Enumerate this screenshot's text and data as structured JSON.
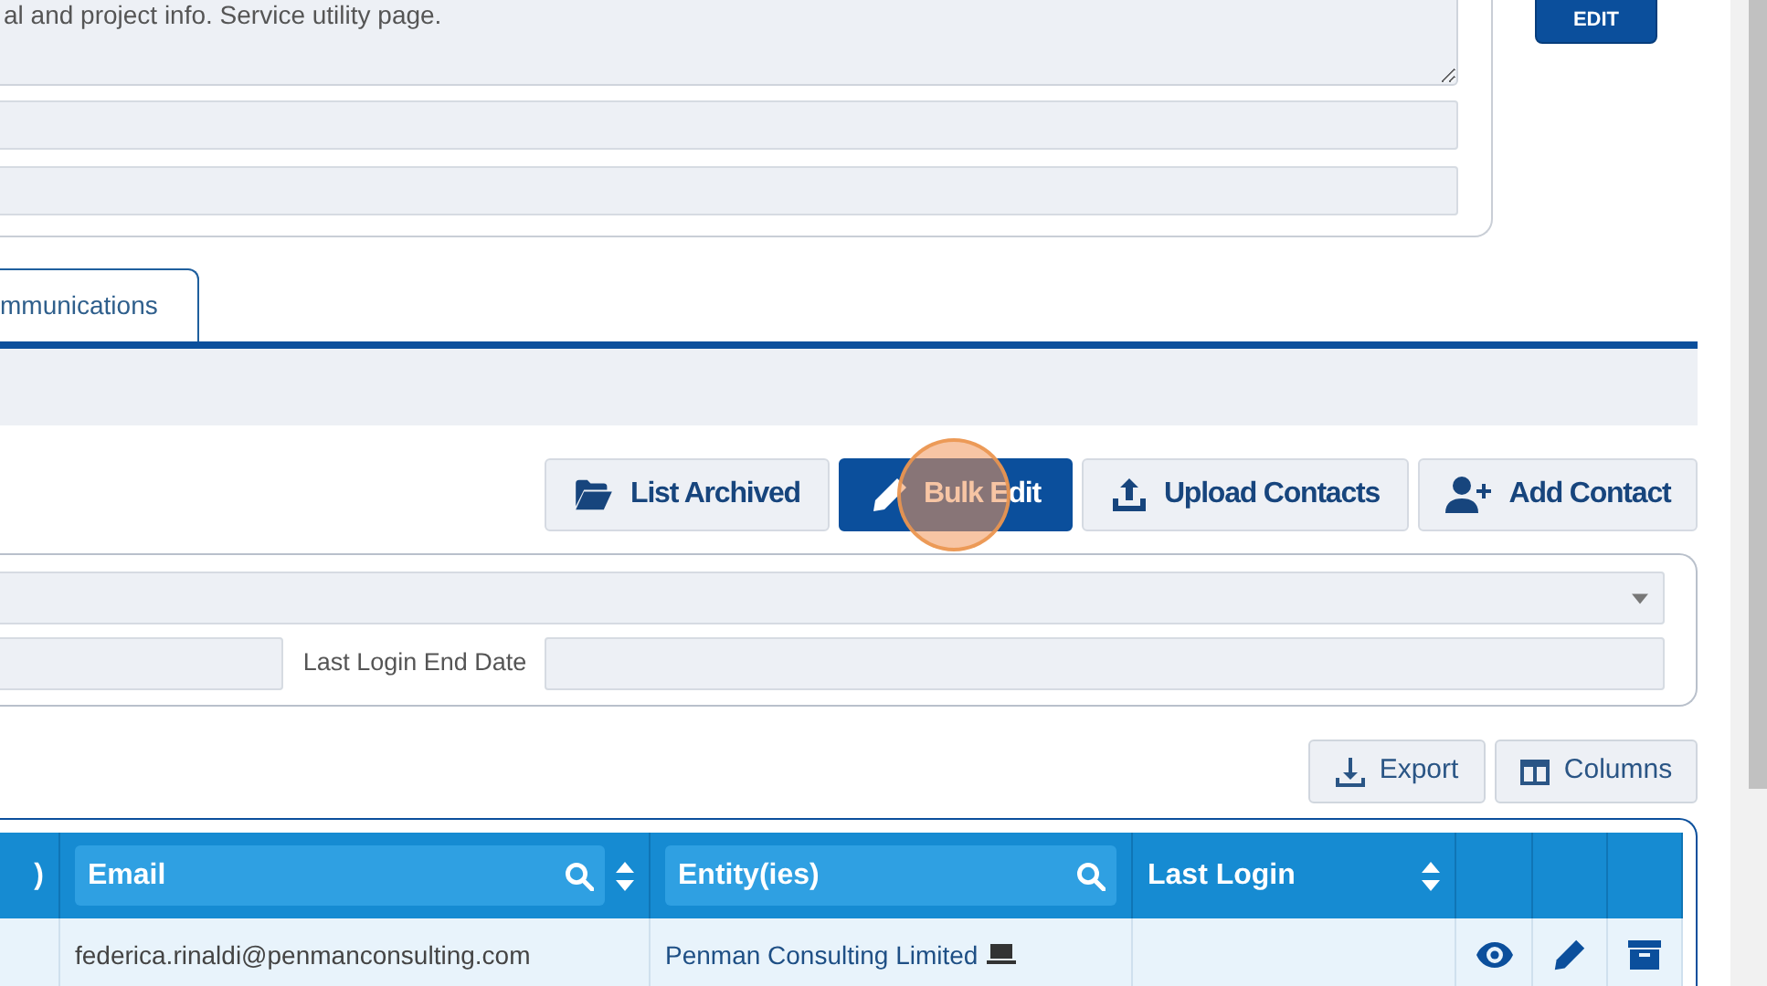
{
  "description": "al and project info. Service utility page.",
  "edit_button": "EDIT",
  "tabs": [
    {
      "label": "mmunications",
      "selected": true
    }
  ],
  "actions": [
    {
      "label": "List Archived",
      "primary": false
    },
    {
      "label": "Bulk Edit",
      "primary": true,
      "clicked": true
    },
    {
      "label": "Upload Contacts",
      "primary": false
    },
    {
      "label": "Add Contact",
      "primary": false
    }
  ],
  "filters": {
    "label": "Last Login End Date"
  },
  "tools": [
    "Export",
    "Columns"
  ],
  "table": {
    "columns": [
      {
        "kind": "text",
        "label": ")",
        "search": false,
        "sort": false
      },
      {
        "kind": "text",
        "label": "Email",
        "search": true,
        "sort": true
      },
      {
        "kind": "text",
        "label": "Entity(ies)",
        "search": true,
        "sort": false
      },
      {
        "kind": "text",
        "label": "Last Login",
        "search": false,
        "sort": true
      },
      {
        "kind": "action"
      },
      {
        "kind": "action"
      },
      {
        "kind": "action"
      }
    ],
    "rows": [
      {
        "email": "federica.rinaldi@penmanconsulting.com",
        "entity": "Penman Consulting Limited"
      }
    ]
  }
}
